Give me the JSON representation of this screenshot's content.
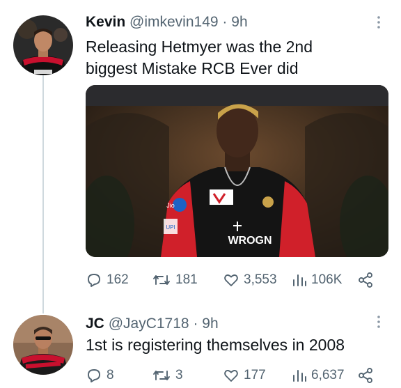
{
  "tweets": [
    {
      "name": "Kevin",
      "handle": "@imkevin149",
      "time": "9h",
      "separator": "·",
      "text_lines": [
        "Releasing Hetmyer was the 2nd",
        "biggest Mistake RCB Ever did"
      ],
      "media": {
        "sponsor_text": "WROGN",
        "jio": "Jio",
        "upi": "UPI"
      },
      "stats": {
        "replies": "162",
        "reposts": "181",
        "likes": "3,553",
        "views": "106K"
      }
    },
    {
      "name": "JC",
      "handle": "@JayC1718",
      "time": "9h",
      "separator": "·",
      "text_lines": [
        "1st is registering themselves in 2008"
      ],
      "stats": {
        "replies": "8",
        "reposts": "3",
        "likes": "177",
        "views": "6,637"
      }
    }
  ],
  "icons": [
    "reply-icon",
    "repost-icon",
    "like-icon",
    "views-icon",
    "share-icon",
    "more-icon"
  ]
}
